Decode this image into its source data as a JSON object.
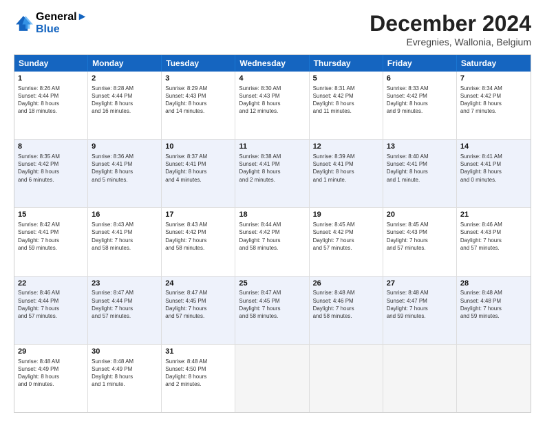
{
  "header": {
    "logo_line1": "General",
    "logo_line2": "Blue",
    "title": "December 2024",
    "subtitle": "Evregnies, Wallonia, Belgium"
  },
  "weekdays": [
    "Sunday",
    "Monday",
    "Tuesday",
    "Wednesday",
    "Thursday",
    "Friday",
    "Saturday"
  ],
  "rows": [
    [
      {
        "day": "1",
        "lines": [
          "Sunrise: 8:26 AM",
          "Sunset: 4:44 PM",
          "Daylight: 8 hours",
          "and 18 minutes."
        ]
      },
      {
        "day": "2",
        "lines": [
          "Sunrise: 8:28 AM",
          "Sunset: 4:44 PM",
          "Daylight: 8 hours",
          "and 16 minutes."
        ]
      },
      {
        "day": "3",
        "lines": [
          "Sunrise: 8:29 AM",
          "Sunset: 4:43 PM",
          "Daylight: 8 hours",
          "and 14 minutes."
        ]
      },
      {
        "day": "4",
        "lines": [
          "Sunrise: 8:30 AM",
          "Sunset: 4:43 PM",
          "Daylight: 8 hours",
          "and 12 minutes."
        ]
      },
      {
        "day": "5",
        "lines": [
          "Sunrise: 8:31 AM",
          "Sunset: 4:42 PM",
          "Daylight: 8 hours",
          "and 11 minutes."
        ]
      },
      {
        "day": "6",
        "lines": [
          "Sunrise: 8:33 AM",
          "Sunset: 4:42 PM",
          "Daylight: 8 hours",
          "and 9 minutes."
        ]
      },
      {
        "day": "7",
        "lines": [
          "Sunrise: 8:34 AM",
          "Sunset: 4:42 PM",
          "Daylight: 8 hours",
          "and 7 minutes."
        ]
      }
    ],
    [
      {
        "day": "8",
        "lines": [
          "Sunrise: 8:35 AM",
          "Sunset: 4:42 PM",
          "Daylight: 8 hours",
          "and 6 minutes."
        ]
      },
      {
        "day": "9",
        "lines": [
          "Sunrise: 8:36 AM",
          "Sunset: 4:41 PM",
          "Daylight: 8 hours",
          "and 5 minutes."
        ]
      },
      {
        "day": "10",
        "lines": [
          "Sunrise: 8:37 AM",
          "Sunset: 4:41 PM",
          "Daylight: 8 hours",
          "and 4 minutes."
        ]
      },
      {
        "day": "11",
        "lines": [
          "Sunrise: 8:38 AM",
          "Sunset: 4:41 PM",
          "Daylight: 8 hours",
          "and 2 minutes."
        ]
      },
      {
        "day": "12",
        "lines": [
          "Sunrise: 8:39 AM",
          "Sunset: 4:41 PM",
          "Daylight: 8 hours",
          "and 1 minute."
        ]
      },
      {
        "day": "13",
        "lines": [
          "Sunrise: 8:40 AM",
          "Sunset: 4:41 PM",
          "Daylight: 8 hours",
          "and 1 minute."
        ]
      },
      {
        "day": "14",
        "lines": [
          "Sunrise: 8:41 AM",
          "Sunset: 4:41 PM",
          "Daylight: 8 hours",
          "and 0 minutes."
        ]
      }
    ],
    [
      {
        "day": "15",
        "lines": [
          "Sunrise: 8:42 AM",
          "Sunset: 4:41 PM",
          "Daylight: 7 hours",
          "and 59 minutes."
        ]
      },
      {
        "day": "16",
        "lines": [
          "Sunrise: 8:43 AM",
          "Sunset: 4:41 PM",
          "Daylight: 7 hours",
          "and 58 minutes."
        ]
      },
      {
        "day": "17",
        "lines": [
          "Sunrise: 8:43 AM",
          "Sunset: 4:42 PM",
          "Daylight: 7 hours",
          "and 58 minutes."
        ]
      },
      {
        "day": "18",
        "lines": [
          "Sunrise: 8:44 AM",
          "Sunset: 4:42 PM",
          "Daylight: 7 hours",
          "and 58 minutes."
        ]
      },
      {
        "day": "19",
        "lines": [
          "Sunrise: 8:45 AM",
          "Sunset: 4:42 PM",
          "Daylight: 7 hours",
          "and 57 minutes."
        ]
      },
      {
        "day": "20",
        "lines": [
          "Sunrise: 8:45 AM",
          "Sunset: 4:43 PM",
          "Daylight: 7 hours",
          "and 57 minutes."
        ]
      },
      {
        "day": "21",
        "lines": [
          "Sunrise: 8:46 AM",
          "Sunset: 4:43 PM",
          "Daylight: 7 hours",
          "and 57 minutes."
        ]
      }
    ],
    [
      {
        "day": "22",
        "lines": [
          "Sunrise: 8:46 AM",
          "Sunset: 4:44 PM",
          "Daylight: 7 hours",
          "and 57 minutes."
        ]
      },
      {
        "day": "23",
        "lines": [
          "Sunrise: 8:47 AM",
          "Sunset: 4:44 PM",
          "Daylight: 7 hours",
          "and 57 minutes."
        ]
      },
      {
        "day": "24",
        "lines": [
          "Sunrise: 8:47 AM",
          "Sunset: 4:45 PM",
          "Daylight: 7 hours",
          "and 57 minutes."
        ]
      },
      {
        "day": "25",
        "lines": [
          "Sunrise: 8:47 AM",
          "Sunset: 4:45 PM",
          "Daylight: 7 hours",
          "and 58 minutes."
        ]
      },
      {
        "day": "26",
        "lines": [
          "Sunrise: 8:48 AM",
          "Sunset: 4:46 PM",
          "Daylight: 7 hours",
          "and 58 minutes."
        ]
      },
      {
        "day": "27",
        "lines": [
          "Sunrise: 8:48 AM",
          "Sunset: 4:47 PM",
          "Daylight: 7 hours",
          "and 59 minutes."
        ]
      },
      {
        "day": "28",
        "lines": [
          "Sunrise: 8:48 AM",
          "Sunset: 4:48 PM",
          "Daylight: 7 hours",
          "and 59 minutes."
        ]
      }
    ],
    [
      {
        "day": "29",
        "lines": [
          "Sunrise: 8:48 AM",
          "Sunset: 4:49 PM",
          "Daylight: 8 hours",
          "and 0 minutes."
        ]
      },
      {
        "day": "30",
        "lines": [
          "Sunrise: 8:48 AM",
          "Sunset: 4:49 PM",
          "Daylight: 8 hours",
          "and 1 minute."
        ]
      },
      {
        "day": "31",
        "lines": [
          "Sunrise: 8:48 AM",
          "Sunset: 4:50 PM",
          "Daylight: 8 hours",
          "and 2 minutes."
        ]
      },
      {
        "day": "",
        "lines": []
      },
      {
        "day": "",
        "lines": []
      },
      {
        "day": "",
        "lines": []
      },
      {
        "day": "",
        "lines": []
      }
    ]
  ]
}
